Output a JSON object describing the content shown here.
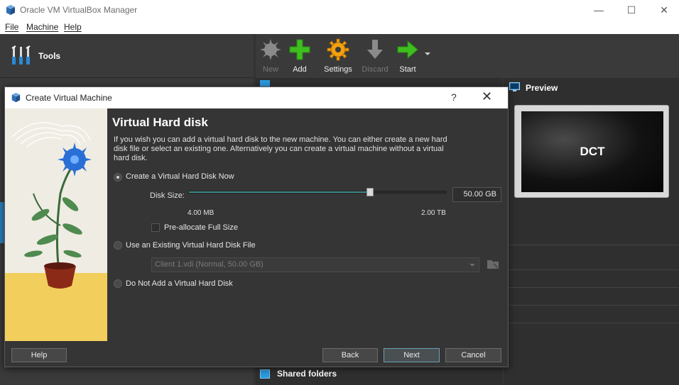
{
  "window": {
    "title": "Oracle VM VirtualBox Manager"
  },
  "menu": [
    "File",
    "Machine",
    "Help"
  ],
  "left_pane": {
    "tools_label": "Tools"
  },
  "toolbar": {
    "new": "New",
    "add": "Add",
    "settings": "Settings",
    "discard": "Discard",
    "start": "Start"
  },
  "preview": {
    "title": "Preview",
    "screen_text": "DCT"
  },
  "details": {
    "shared_folders": "Shared folders"
  },
  "dialog": {
    "title": "Create Virtual Machine",
    "help_glyph": "?",
    "close_glyph": "✕",
    "heading": "Virtual Hard disk",
    "description": "If you wish you can add a virtual hard disk to the new machine. You can either create a new hard disk file or select an existing one. Alternatively you can create a virtual machine without a virtual hard disk.",
    "options": {
      "create_now": "Create a Virtual Hard Disk Now",
      "use_existing": "Use an Existing Virtual Hard Disk File",
      "do_not_add": "Do Not Add a Virtual Hard Disk"
    },
    "selected_option": "create_now",
    "disk_size_label": "Disk Size:",
    "disk_size_value": "50.00 GB",
    "slider_min": "4.00 MB",
    "slider_max": "2.00 TB",
    "slider_fraction": 0.705,
    "preallocate_label": "Pre-allocate Full Size",
    "preallocate_checked": false,
    "existing_file": "Client 1.vdi (Normal, 50.00 GB)",
    "buttons": {
      "help": "Help",
      "back": "Back",
      "next": "Next",
      "cancel": "Cancel"
    }
  },
  "colors": {
    "accent": "#2b7fb8",
    "slider_fill": "#3c8a8a",
    "add_green": "#3fbf1f",
    "settings_orange": "#f0a010"
  }
}
